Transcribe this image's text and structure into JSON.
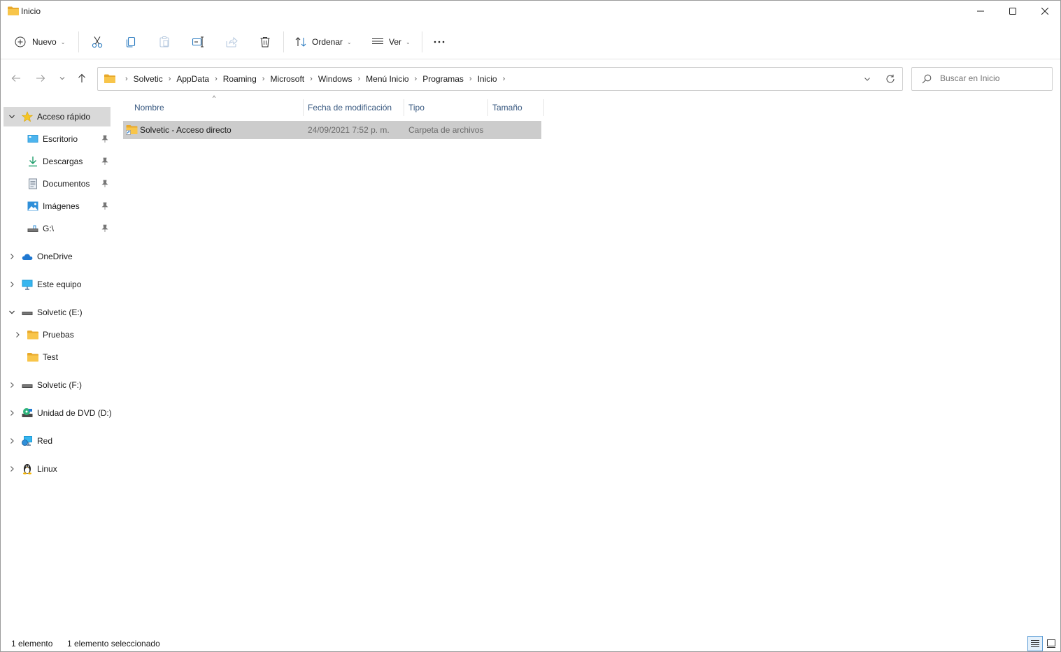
{
  "window": {
    "title": "Inicio",
    "minimize_icon": "minimize-icon",
    "maximize_icon": "maximize-icon",
    "close_icon": "close-icon"
  },
  "toolbar": {
    "new_label": "Nuevo",
    "sort_label": "Ordenar",
    "view_label": "Ver",
    "icons": [
      "cut-icon",
      "copy-icon",
      "paste-icon",
      "rename-icon",
      "share-icon",
      "delete-icon",
      "more-icon"
    ]
  },
  "address": {
    "crumbs": [
      "Solvetic",
      "AppData",
      "Roaming",
      "Microsoft",
      "Windows",
      "Menú Inicio",
      "Programas",
      "Inicio"
    ]
  },
  "search": {
    "placeholder": "Buscar en Inicio"
  },
  "nav": {
    "quick_access": "Acceso rápido",
    "pinned": [
      "Escritorio",
      "Descargas",
      "Documentos",
      "Imágenes",
      "G:\\"
    ],
    "onedrive": "OneDrive",
    "this_pc": "Este equipo",
    "drive_e": "Solvetic (E:)",
    "folder_pruebas": "Pruebas",
    "folder_test": "Test",
    "drive_f": "Solvetic (F:)",
    "dvd": "Unidad de DVD (D:)",
    "network": "Red",
    "linux": "Linux"
  },
  "columns": {
    "name": "Nombre",
    "modified": "Fecha de modificación",
    "type": "Tipo",
    "size": "Tamaño"
  },
  "files": [
    {
      "name": "Solvetic - Acceso directo",
      "modified": "24/09/2021 7:52 p. m.",
      "type": "Carpeta de archivos",
      "size": ""
    }
  ],
  "status": {
    "count": "1 elemento",
    "selected": "1 elemento seleccionado"
  },
  "colors": {
    "folder": "#f8c54a",
    "selection": "#cccccc",
    "accent": "#0067c0"
  }
}
